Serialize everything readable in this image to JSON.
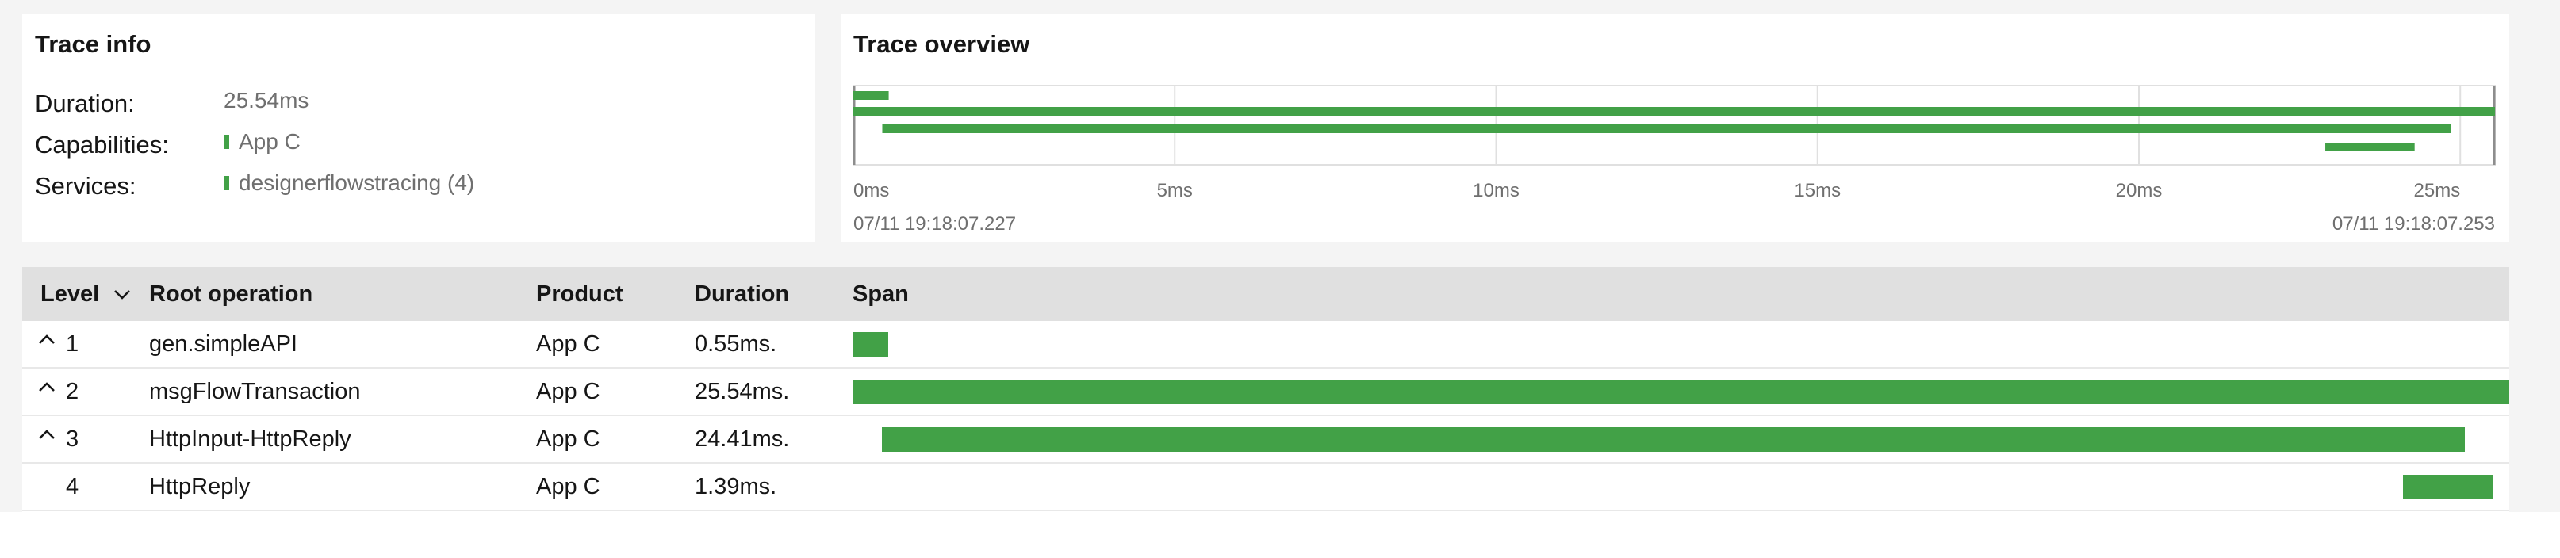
{
  "trace_info": {
    "title": "Trace info",
    "duration_label": "Duration:",
    "duration_value": "25.54ms",
    "capabilities_label": "Capabilities:",
    "capabilities_value": "App C",
    "services_label": "Services:",
    "services_value": "designerflowstracing (4)"
  },
  "trace_overview": {
    "title": "Trace overview",
    "start_timestamp": "07/11 19:18:07.227",
    "end_timestamp": "07/11 19:18:07.253"
  },
  "chart_data": {
    "type": "bar",
    "title": "Trace overview",
    "x_unit": "ms",
    "xlim": [
      0,
      25.54
    ],
    "ticks": [
      {
        "value": 0,
        "label": "0ms"
      },
      {
        "value": 5,
        "label": "5ms"
      },
      {
        "value": 10,
        "label": "10ms"
      },
      {
        "value": 15,
        "label": "15ms"
      },
      {
        "value": 20,
        "label": "20ms"
      },
      {
        "value": 25,
        "label": "25ms"
      }
    ],
    "spans": [
      {
        "start": 0.0,
        "duration": 0.55
      },
      {
        "start": 0.0,
        "duration": 25.54
      },
      {
        "start": 0.45,
        "duration": 24.41
      },
      {
        "start": 22.9,
        "duration": 1.39
      }
    ],
    "grid": true,
    "bar_color": "#42a147"
  },
  "table": {
    "headers": {
      "level": "Level",
      "root_operation": "Root operation",
      "product": "Product",
      "duration": "Duration",
      "span": "Span"
    },
    "rows": [
      {
        "level": "1",
        "operation": "gen.simpleAPI",
        "product": "App C",
        "duration": "0.55ms.",
        "expandable": true,
        "start": 0.0,
        "length": 0.55
      },
      {
        "level": "2",
        "operation": "msgFlowTransaction",
        "product": "App C",
        "duration": "25.54ms.",
        "expandable": true,
        "start": 0.0,
        "length": 25.54
      },
      {
        "level": "3",
        "operation": "HttpInput-HttpReply",
        "product": "App C",
        "duration": "24.41ms.",
        "expandable": true,
        "start": 0.45,
        "length": 24.41
      },
      {
        "level": "4",
        "operation": "HttpReply",
        "product": "App C",
        "duration": "1.39ms.",
        "expandable": false,
        "start": 23.9,
        "length": 1.39
      }
    ]
  },
  "colors": {
    "accent": "#42a147",
    "header_bg": "#e0e0e0",
    "page_bg": "#f4f4f4"
  },
  "icons": {
    "sort": "chevron-down-icon",
    "expand": "chevron-up-icon",
    "swatch": "green-swatch"
  }
}
